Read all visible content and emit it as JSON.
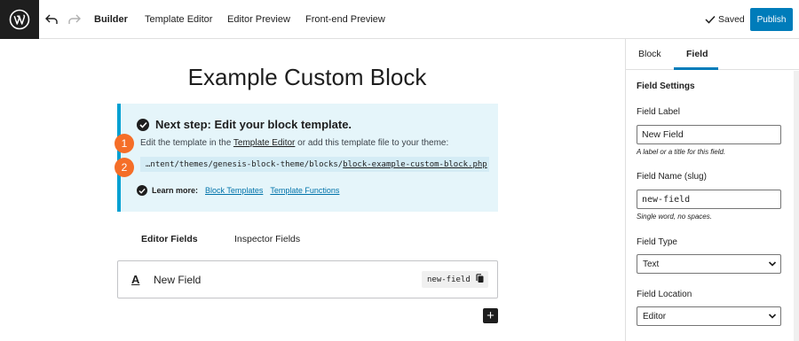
{
  "topbar": {
    "nav": [
      "Builder",
      "Template Editor",
      "Editor Preview",
      "Front-end Preview"
    ],
    "saved_label": "Saved",
    "publish_label": "Publish"
  },
  "editor": {
    "block_title": "Example Custom Block",
    "notice": {
      "heading": "Next step: Edit your block template.",
      "line1_prefix": "Edit the template in the",
      "line1_link": "Template Editor",
      "line1_suffix": "or add this template file to your theme:",
      "path_prefix": "…ntent/themes/genesis-block-theme/blocks/",
      "path_file": "block-example-custom-block.php",
      "learn_more_label": "Learn more:",
      "learn_links": [
        "Block Templates",
        "Template Functions"
      ]
    },
    "steps": [
      "1",
      "2"
    ],
    "field_tabs": [
      "Editor Fields",
      "Inspector Fields"
    ],
    "field": {
      "icon_glyph": "A",
      "label": "New Field",
      "slug": "new-field"
    },
    "add_glyph": "+"
  },
  "sidebar": {
    "tabs": [
      "Block",
      "Field"
    ],
    "heading": "Field Settings",
    "field_label_title": "Field Label",
    "field_label_value": "New Field",
    "field_label_help": "A label or a title for this field.",
    "field_name_title": "Field Name (slug)",
    "field_name_value": "new-field",
    "field_name_help": "Single word, no spaces.",
    "field_type_title": "Field Type",
    "field_type_value": "Text",
    "field_location_title": "Field Location",
    "field_location_value": "Editor"
  },
  "colors": {
    "accent": "#007cba",
    "notice_bg": "#e5f5fa",
    "notice_border": "#00a0d2",
    "step_badge": "#f56e28"
  },
  "icons": {
    "logo": "wordpress-logo-icon",
    "undo": "undo-icon",
    "redo": "redo-icon",
    "saved": "check-icon",
    "copy": "copy-icon",
    "chevron": "chevron-down-icon"
  }
}
